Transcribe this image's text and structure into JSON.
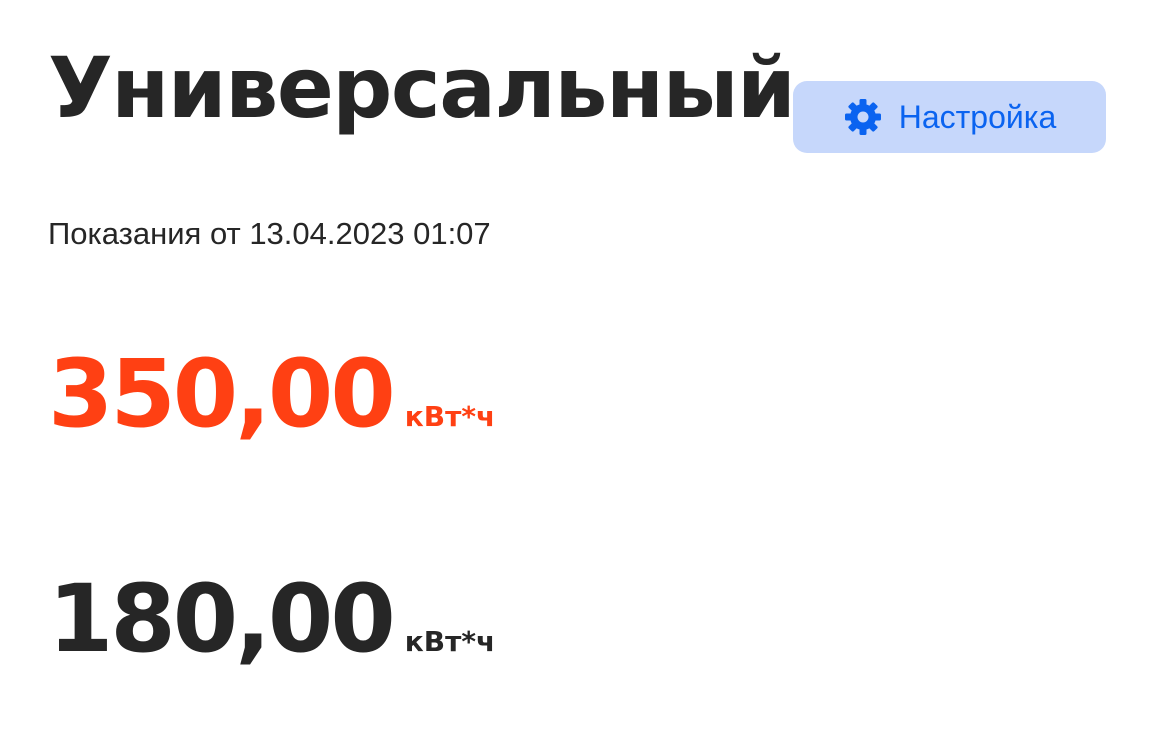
{
  "header": {
    "title": "Универсальный",
    "settings_button": {
      "label": "Настройка",
      "icon": "gear-icon"
    }
  },
  "readings_date": "Показания от 13.04.2023 01:07",
  "readings": [
    {
      "value": "350,00",
      "unit": "кВт*ч"
    },
    {
      "value": "180,00",
      "unit": "кВт*ч"
    }
  ],
  "colors": {
    "accent": "#ff4013",
    "primary_text": "#262626",
    "button_bg": "#c6d7fb",
    "button_text": "#0a63f0"
  }
}
